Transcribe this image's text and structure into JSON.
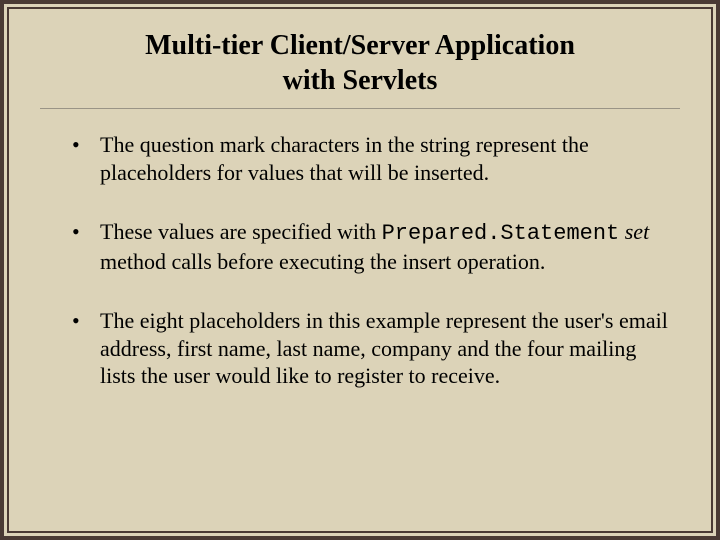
{
  "title": {
    "line1": "Multi-tier Client/Server Application",
    "line2": "with Servlets"
  },
  "bullets": [
    {
      "parts": [
        {
          "text": "The question mark characters in the string represent the placeholders for values that will be inserted.",
          "style": "normal"
        }
      ]
    },
    {
      "parts": [
        {
          "text": "These values are specified with ",
          "style": "normal"
        },
        {
          "text": "Prepared.Statement",
          "style": "code"
        },
        {
          "text": " ",
          "style": "normal"
        },
        {
          "text": "set",
          "style": "italic"
        },
        {
          "text": " method calls before executing the insert operation.",
          "style": "normal"
        }
      ]
    },
    {
      "parts": [
        {
          "text": "The eight placeholders in this example represent the user's email address, first name, last name, company and the four mailing lists the user would like to register to receive.",
          "style": "normal"
        }
      ]
    }
  ]
}
